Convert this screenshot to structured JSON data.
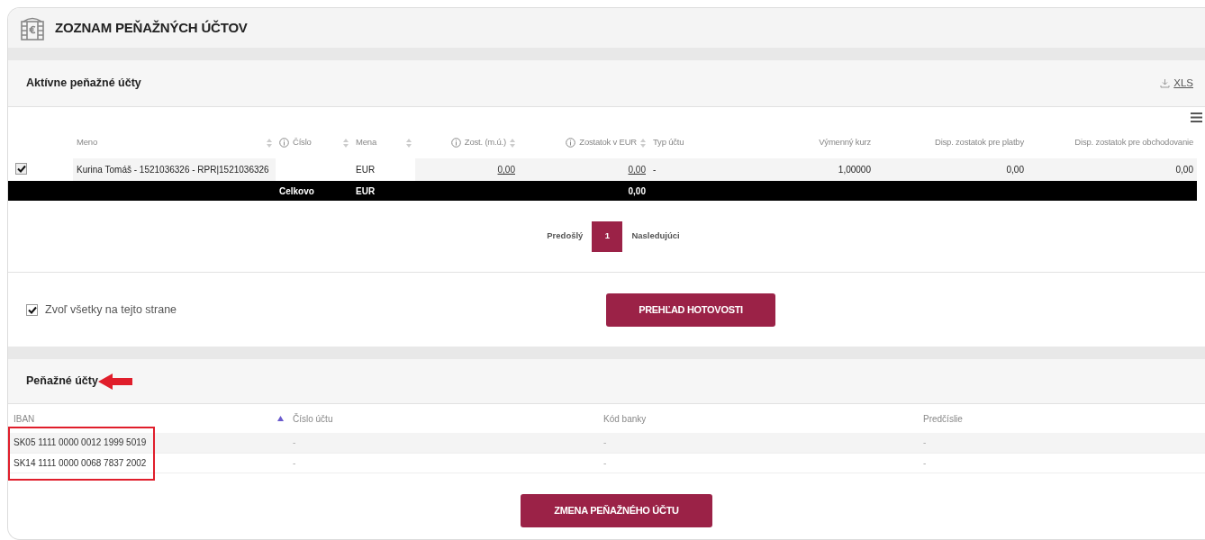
{
  "page": {
    "title": "ZOZNAM PEŇAŽNÝCH ÚČTOV"
  },
  "active_accounts": {
    "title": "Aktívne peňažné účty",
    "export_link": "XLS",
    "columns": [
      {
        "label": "Meno",
        "info": false,
        "sortable": true
      },
      {
        "label": "Číslo",
        "info": true,
        "sortable": true
      },
      {
        "label": "Mena",
        "info": false,
        "sortable": true
      },
      {
        "label": "Zost. (m.ú.)",
        "info": true,
        "sortable": true
      },
      {
        "label": "Zostatok v EUR",
        "info": true,
        "sortable": true
      },
      {
        "label": "Typ účtu",
        "info": false,
        "sortable": false
      },
      {
        "label": "Výmenný kurz",
        "info": false,
        "sortable": false
      },
      {
        "label": "Disp. zostatok pre platby",
        "info": false,
        "sortable": false
      },
      {
        "label": "Disp. zostatok pre obchodovanie",
        "info": false,
        "sortable": false
      }
    ],
    "rows": [
      {
        "selected": true,
        "cells": [
          {
            "text": "Kurina Tomáš - 1521036326 - RPR|1521036326",
            "link": false
          },
          null,
          {
            "text": "EUR",
            "link": false
          },
          {
            "text": "0,00",
            "link": true
          },
          {
            "text": "0,00",
            "link": true
          },
          {
            "text": "-",
            "link": false
          },
          {
            "text": "1,00000",
            "link": false
          },
          {
            "text": "0,00",
            "link": false
          },
          {
            "text": "0,00",
            "link": false
          }
        ]
      }
    ],
    "total": {
      "label": "Celkovo",
      "currency": "EUR",
      "balance_eur": "0,00"
    },
    "pagination": {
      "previous": "Predošlý",
      "pages": [
        {
          "label": "1",
          "selected": true
        }
      ],
      "next": "Nasledujúci"
    },
    "select_all": {
      "label": "Zvoľ všetky na tejto strane",
      "checked": true
    },
    "button": "PREHĽAD HOTOVOSTI"
  },
  "money_accounts": {
    "title": "Peňažné účty",
    "columns": [
      {
        "label": "IBAN",
        "sorted": true
      },
      {
        "label": "Číslo účtu",
        "sorted": false
      },
      {
        "label": "Kód banky",
        "sorted": false
      },
      {
        "label": "Predčíslie",
        "sorted": false
      }
    ],
    "rows": [
      [
        "SK05 1111 0000 0012 1999 5019",
        "-",
        "-",
        "-"
      ],
      [
        "SK14 1111 0000 0068 7837 2002",
        "-",
        "-",
        "-"
      ]
    ],
    "button": "ZMENA PEŇAŽNÉHO ÚČTU"
  }
}
